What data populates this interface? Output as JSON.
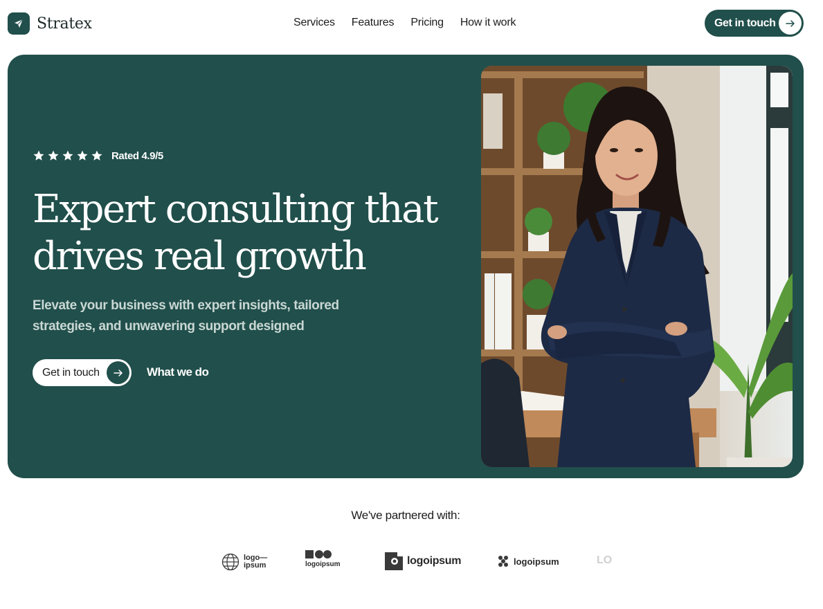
{
  "brand": {
    "name": "Stratex",
    "icon": "paper-plane-icon"
  },
  "nav": {
    "links": [
      "Services",
      "Features",
      "Pricing",
      "How it work"
    ],
    "cta_label": "Get in touch"
  },
  "hero": {
    "rating_stars": 5,
    "rating_text": "Rated 4.9/5",
    "headline_line1": "Expert consulting that",
    "headline_line2": "drives real growth",
    "subhead_line1": "Elevate your business with expert insights, tailored",
    "subhead_line2": "strategies, and unwavering support designed",
    "primary_button": "Get in touch",
    "secondary_button": "What we do"
  },
  "partners": {
    "title": "We've partnered with:",
    "logos": [
      "logo— ipsum",
      "logoipsum",
      "logoipsum",
      "logoipsum",
      "LO"
    ]
  },
  "colors": {
    "brand_green": "#214f4b",
    "subhead": "#c9d7d4",
    "white": "#ffffff"
  }
}
